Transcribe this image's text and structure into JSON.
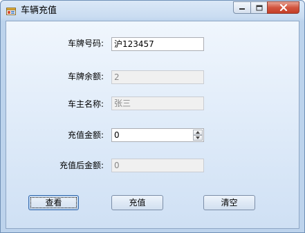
{
  "window": {
    "title": "车辆充值",
    "icon": "app-form-icon"
  },
  "form": {
    "plate_number": {
      "label": "车牌号码:",
      "value": "沪123457"
    },
    "plate_balance": {
      "label": "车牌余额:",
      "value": "2"
    },
    "owner_name": {
      "label": "车主名称:",
      "value": "张三"
    },
    "recharge_amount": {
      "label": "充值金额:",
      "value": "0"
    },
    "balance_after": {
      "label": "充值后金额:",
      "value": "0"
    }
  },
  "buttons": {
    "query": "查看",
    "recharge": "充值",
    "clear": "清空"
  },
  "colors": {
    "close_button": "#c9462f",
    "client_background": "#dce9f8",
    "readonly_field": "#f0f0f0"
  }
}
